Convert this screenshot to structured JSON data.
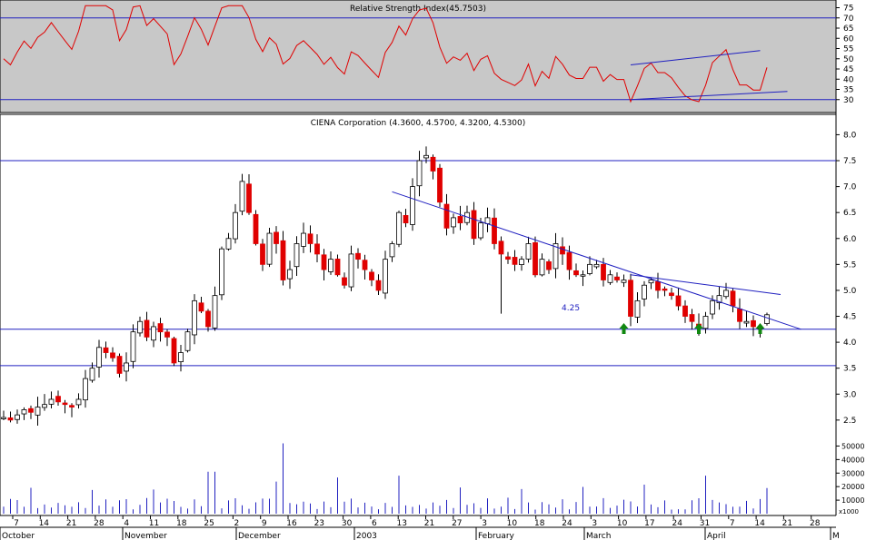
{
  "rsi_panel": {
    "title": "Relative Strength Index(45.7503)",
    "ylim": [
      25,
      77
    ],
    "ticks": [
      30,
      35,
      40,
      45,
      50,
      55,
      60,
      65,
      70,
      75
    ],
    "levels": [
      70,
      30
    ],
    "colors": {
      "line": "#e00000",
      "level": "#2020c0",
      "trend": "#2020c0",
      "bg": "#c8c8c8"
    }
  },
  "price_panel": {
    "title": "CIENA Corporation (4.3600, 4.5700, 4.3200, 4.5300)",
    "ylim": [
      2.2,
      8.2
    ],
    "ticks": [
      "2.5",
      "3.0",
      "3.5",
      "4.0",
      "4.5",
      "5.0",
      "5.5",
      "6.0",
      "6.5",
      "7.0",
      "7.5",
      "8.0"
    ],
    "hlines": [
      7.5,
      4.25,
      3.55
    ],
    "annotation": "4.25",
    "colors": {
      "up": "#ffffff",
      "down": "#e00000",
      "outline": "#000000",
      "trend": "#2020c0",
      "arrow": "#118811"
    }
  },
  "volume_panel": {
    "ticks": [
      "10000",
      "20000",
      "30000",
      "40000",
      "50000"
    ],
    "multiplier": "x1000",
    "color": "#2020c0"
  },
  "x_axis": {
    "day_labels": [
      "7",
      "14",
      "21",
      "28",
      "4",
      "11",
      "18",
      "25",
      "2",
      "9",
      "16",
      "23",
      "30",
      "6",
      "13",
      "21",
      "27",
      "3",
      "10",
      "18",
      "24",
      "3",
      "10",
      "17",
      "24",
      "31",
      "7",
      "14",
      "21",
      "28"
    ],
    "month_labels": [
      "October",
      "November",
      "December",
      "2003",
      "February",
      "March",
      "April",
      "M"
    ]
  },
  "chart_data": {
    "type": "candlestick",
    "title": "CIENA Corporation (4.3600, 4.5700, 4.3200, 4.5300)",
    "last_bar": {
      "open": 4.36,
      "high": 4.57,
      "low": 4.32,
      "close": 4.53
    },
    "rsi_last": 45.7503,
    "support_level": 4.25,
    "resistance_level": 7.5,
    "lower_level": 3.55,
    "closes": [
      2.55,
      2.5,
      2.6,
      2.7,
      2.65,
      2.75,
      2.8,
      2.9,
      2.85,
      2.8,
      2.75,
      2.9,
      3.3,
      3.5,
      3.9,
      3.8,
      3.7,
      3.4,
      3.6,
      4.2,
      4.4,
      4.1,
      4.3,
      4.2,
      4.1,
      3.6,
      3.8,
      4.2,
      4.8,
      4.6,
      4.3,
      4.9,
      5.8,
      6.0,
      6.5,
      7.1,
      6.5,
      5.9,
      5.5,
      6.1,
      5.9,
      5.2,
      5.4,
      5.9,
      6.1,
      5.9,
      5.7,
      5.4,
      5.6,
      5.3,
      5.1,
      5.7,
      5.6,
      5.4,
      5.2,
      5.0,
      5.6,
      5.9,
      6.5,
      6.3,
      7.0,
      7.5,
      7.6,
      7.3,
      6.7,
      6.2,
      6.4,
      6.3,
      6.5,
      6.0,
      6.3,
      6.4,
      5.9,
      5.7,
      5.6,
      5.5,
      5.6,
      5.9,
      5.3,
      5.6,
      5.4,
      5.9,
      5.7,
      5.4,
      5.3,
      5.3,
      5.5,
      5.5,
      5.2,
      5.3,
      5.2,
      5.2,
      4.5,
      4.8,
      5.1,
      5.2,
      5.0,
      5.0,
      4.9,
      4.7,
      4.5,
      4.4,
      4.3,
      4.5,
      4.8,
      4.9,
      5.0,
      4.7,
      4.4,
      4.4,
      4.3,
      4.3,
      4.53
    ]
  }
}
